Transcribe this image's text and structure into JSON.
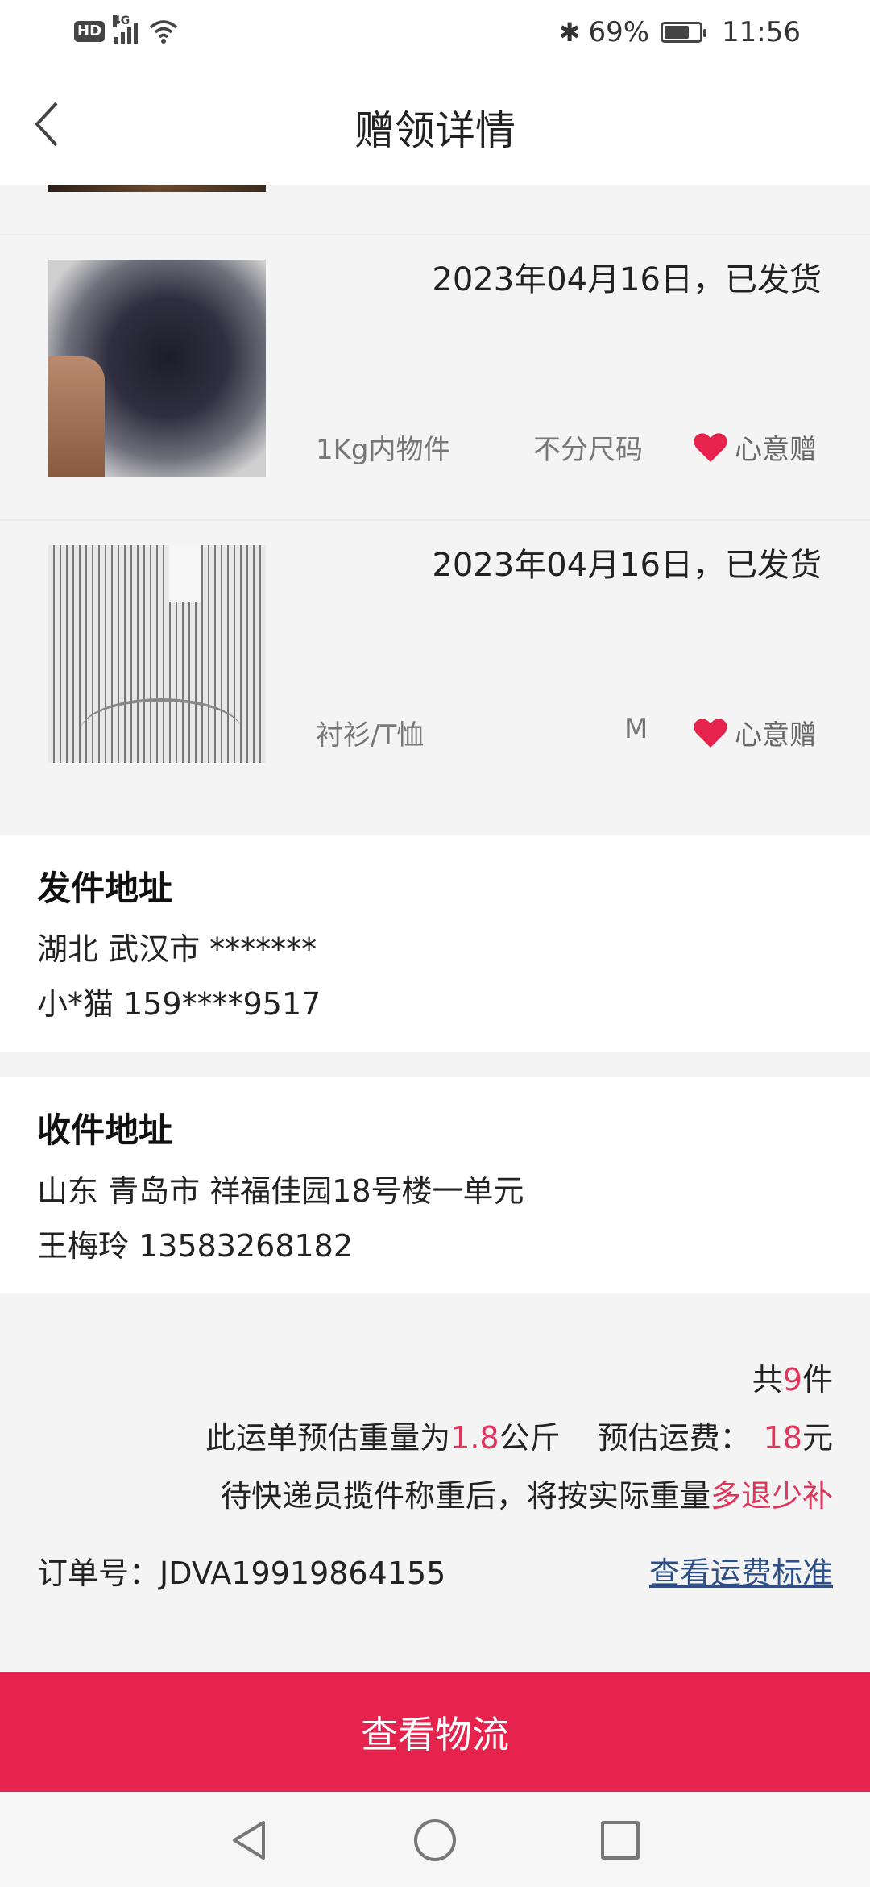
{
  "status_bar": {
    "hd": "HD",
    "network": "4G",
    "battery": "69%",
    "battery_level": 0.69,
    "time": "11:56"
  },
  "header": {
    "title": "赠领详情"
  },
  "items": [
    {
      "date_status": "2023年04月16日，已发货",
      "category": "1Kg内物件",
      "size": "不分尺码",
      "gift": "心意赠"
    },
    {
      "date_status": "2023年04月16日，已发货",
      "category": "衬衫/T恤",
      "size": "M",
      "gift": "心意赠"
    }
  ],
  "sender": {
    "title": "发件地址",
    "address": "湖北 武汉市 *******",
    "contact": "小*猫 159****9517"
  },
  "receiver": {
    "title": "收件地址",
    "address": "山东 青岛市 祥福佳园18号楼一单元",
    "contact": "王梅玲 13583268182"
  },
  "summary": {
    "total_prefix": "共",
    "total_count": "9",
    "total_suffix": "件",
    "weight_prefix": "此运单预估重量为",
    "weight_value": "1.8",
    "weight_unit": "公斤",
    "fee_prefix": "预估运费：",
    "fee_value": "18",
    "fee_unit": "元",
    "notice_prefix": "待快递员揽件称重后，将按实际重量",
    "notice_highlight": "多退少补",
    "order_label": "订单号：",
    "order_no": "JDVA19919864155",
    "fee_link": "查看运费标准"
  },
  "actions": {
    "logistics_button": "查看物流"
  },
  "colors": {
    "accent": "#e6234d",
    "highlight_red": "#e0345a",
    "link_blue": "#2d4f86"
  }
}
